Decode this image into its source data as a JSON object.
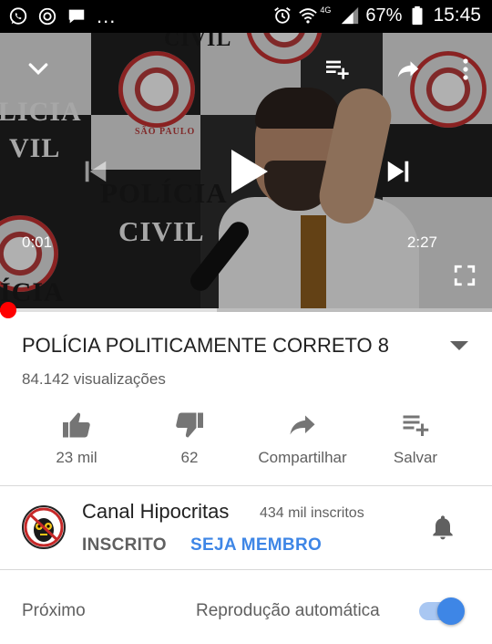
{
  "status_bar": {
    "left_icons": [
      "whatsapp-icon",
      "notification-icon",
      "message-icon"
    ],
    "overflow": "...",
    "network": "4G",
    "battery": "67%",
    "time": "15:45",
    "right_icons": [
      "alarm-icon",
      "wifi-icon",
      "signal-icon",
      "battery-icon"
    ]
  },
  "video": {
    "backdrop_text": [
      "POLÍCIA",
      "CIVIL",
      "LICIA",
      "VIL",
      "CIVIL",
      "ÍCIA"
    ],
    "seal_text": "SÃO PAULO",
    "current_time": "0:01",
    "duration": "2:27",
    "progress": 0.007,
    "buffered": 0.44,
    "icons": [
      "collapse-icon",
      "add-to-playlist-icon",
      "share-icon",
      "more-icon",
      "previous-icon",
      "play-icon",
      "next-icon",
      "fullscreen-icon"
    ],
    "accent": "#ff0000"
  },
  "info": {
    "title": "POLÍCIA POLITICAMENTE CORRETO 8",
    "views": "84.142 visualizações"
  },
  "actions": [
    {
      "label": "23 mil",
      "icon": "thumbs-up-icon"
    },
    {
      "label": "62",
      "icon": "thumbs-down-icon"
    },
    {
      "label": "Compartilhar",
      "icon": "share-icon"
    },
    {
      "label": "Salvar",
      "icon": "add-to-playlist-icon"
    }
  ],
  "channel": {
    "name": "Canal Hipocritas",
    "subscribers": "434 mil inscritos",
    "subscribe_label": "INSCRITO",
    "join_label": "SEJA MEMBRO",
    "join_color": "#3e86e6"
  },
  "up_next": {
    "label": "Próximo",
    "autoplay_label": "Reprodução automática",
    "autoplay_on": true,
    "toggle_color": "#3e86e6"
  }
}
